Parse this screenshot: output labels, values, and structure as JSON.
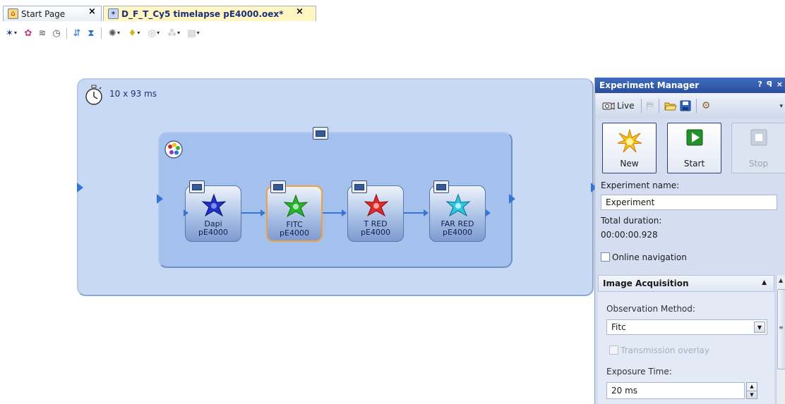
{
  "tabs": [
    {
      "label": "Start Page",
      "active": false
    },
    {
      "label": "D_F_T_Cy5  timelapse pE4000.oex*",
      "active": true
    }
  ],
  "toolbar": {
    "icons": [
      "experiment-icon",
      "palette-icon",
      "layers-icon",
      "timer-icon",
      "branch-icon",
      "hourglass-icon",
      "fan-icon",
      "bulb-icon",
      "disc-icon",
      "grid-icon",
      "export-icon"
    ]
  },
  "workflow": {
    "timelapse_label": "10 x 93 ms",
    "channels": [
      {
        "name": "Dapi",
        "device": "pE4000",
        "color": "#2030c8",
        "selected": false
      },
      {
        "name": "FITC",
        "device": "pE4000",
        "color": "#28b428",
        "selected": true
      },
      {
        "name": "T RED",
        "device": "pE4000",
        "color": "#e02a2a",
        "selected": false
      },
      {
        "name": "FAR RED",
        "device": "pE4000",
        "color": "#2ac8e0",
        "selected": false
      }
    ]
  },
  "experiment_manager": {
    "title": "Experiment Manager",
    "header_buttons": [
      "?",
      "p",
      "×"
    ],
    "live_label": "Live",
    "buttons": {
      "new": "New",
      "start": "Start",
      "stop": "Stop"
    },
    "experiment_name_label": "Experiment name:",
    "experiment_name_value": "Experiment",
    "total_duration_label": "Total duration:",
    "total_duration_value": "00:00:00.928",
    "online_navigation_label": "Online navigation",
    "image_acquisition": {
      "title": "Image Acquisition",
      "observation_method_label": "Observation Method:",
      "observation_method_value": "Fitc",
      "transmission_overlay_label": "Transmission overlay",
      "exposure_time_label": "Exposure Time:",
      "exposure_time_value": "20 ms"
    }
  },
  "colors": {
    "accent": "#3575d6",
    "outer_block": "#c7d9f4",
    "inner_block": "#a4c0ec",
    "selection": "#f0a040",
    "panel_header": "#2a4f9c"
  }
}
